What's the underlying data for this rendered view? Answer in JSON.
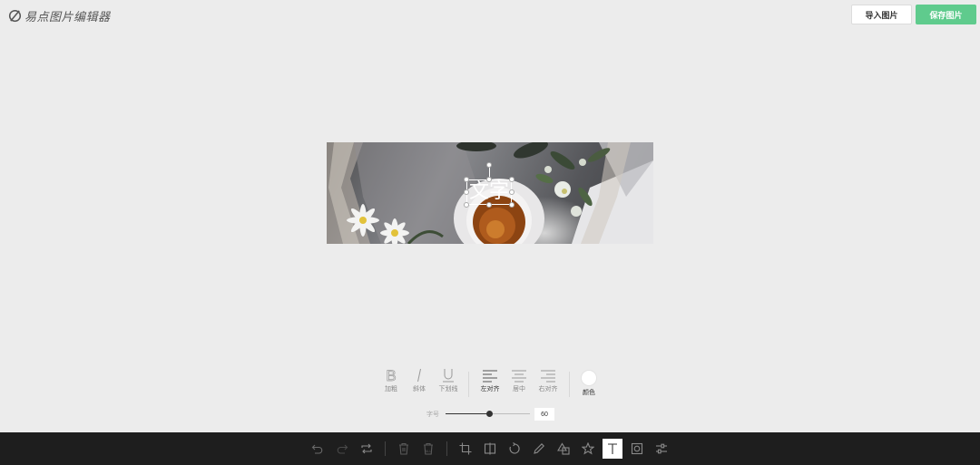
{
  "app": {
    "title": "易点图片编辑器",
    "logo_icon": "brand-logo-icon"
  },
  "header": {
    "import_label": "导入图片",
    "save_label": "保存图片",
    "accent_color": "#5fcb8d"
  },
  "canvas": {
    "text_layer": "文字"
  },
  "text_tools": {
    "style": [
      {
        "label": "加粗",
        "icon": "bold-icon"
      },
      {
        "label": "斜体",
        "icon": "italic-icon"
      },
      {
        "label": "下划线",
        "icon": "underline-icon"
      }
    ],
    "align": [
      {
        "label": "左对齐",
        "icon": "align-left-icon",
        "active": true
      },
      {
        "label": "居中",
        "icon": "align-center-icon",
        "active": false
      },
      {
        "label": "右对齐",
        "icon": "align-right-icon",
        "active": false
      }
    ],
    "color": {
      "label": "颜色",
      "value": "#ffffff"
    },
    "size": {
      "label": "字号",
      "value": "60",
      "slider_fraction": 0.52
    }
  },
  "toolbar": {
    "buttons": [
      {
        "icon": "undo-icon",
        "active": false
      },
      {
        "icon": "redo-icon",
        "active": false
      },
      {
        "icon": "reset-icon",
        "active": false
      },
      {
        "icon": "delete-icon",
        "active": false
      },
      {
        "icon": "delete-all-icon",
        "active": false
      },
      {
        "icon": "crop-icon",
        "active": false
      },
      {
        "icon": "flip-icon",
        "active": false
      },
      {
        "icon": "rotate-icon",
        "active": false
      },
      {
        "icon": "draw-icon",
        "active": false
      },
      {
        "icon": "shape-icon",
        "active": false
      },
      {
        "icon": "star-icon",
        "active": false
      },
      {
        "icon": "text-icon",
        "active": true
      },
      {
        "icon": "mask-icon",
        "active": false
      },
      {
        "icon": "filter-icon",
        "active": false
      }
    ]
  }
}
